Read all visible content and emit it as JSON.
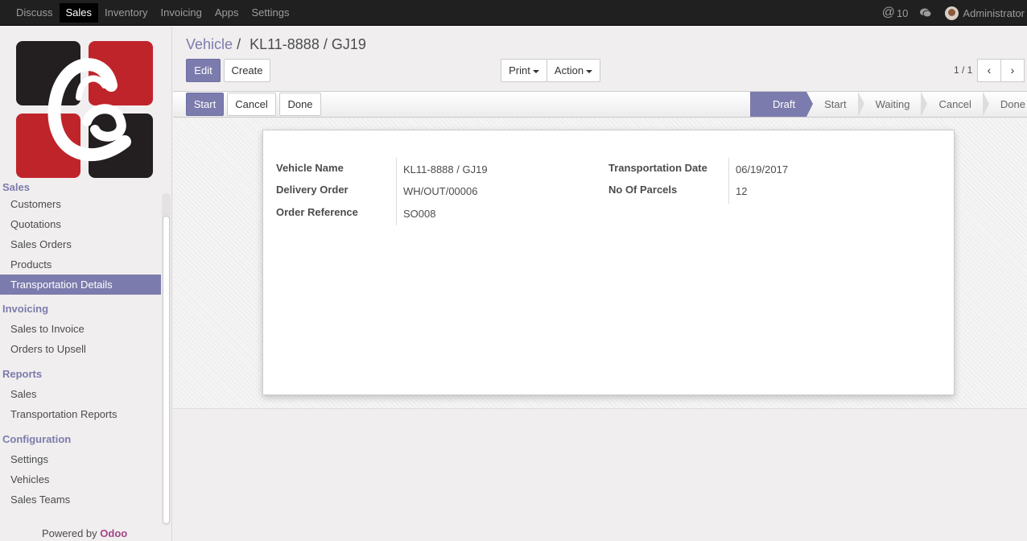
{
  "topbar": {
    "menu": [
      "Discuss",
      "Sales",
      "Inventory",
      "Invoicing",
      "Apps",
      "Settings"
    ],
    "notifications": "10",
    "user": "Administrator"
  },
  "sidebar": {
    "sections": [
      {
        "title": "Sales",
        "items": [
          "Customers",
          "Quotations",
          "Sales Orders",
          "Products",
          "Transportation Details"
        ]
      },
      {
        "title": "Invoicing",
        "items": [
          "Sales to Invoice",
          "Orders to Upsell"
        ]
      },
      {
        "title": "Reports",
        "items": [
          "Sales",
          "Transportation Reports"
        ]
      },
      {
        "title": "Configuration",
        "items": [
          "Settings",
          "Vehicles",
          "Sales Teams"
        ]
      }
    ],
    "active_item": "Transportation Details",
    "powered_by": "Powered by",
    "brand": "Odoo"
  },
  "breadcrumb": {
    "parent": "Vehicle",
    "separator": "/",
    "current": "KL11-8888 / GJ19"
  },
  "buttons": {
    "edit": "Edit",
    "create": "Create",
    "print": "Print",
    "action": "Action"
  },
  "pager": {
    "text": "1 / 1",
    "prev": "‹",
    "next": "›"
  },
  "statusbar": {
    "buttons": {
      "start": "Start",
      "cancel": "Cancel",
      "done": "Done"
    },
    "stages": [
      "Draft",
      "Start",
      "Waiting",
      "Cancel",
      "Done"
    ],
    "active_stage": "Draft"
  },
  "form": {
    "vehicle_name": {
      "label": "Vehicle Name",
      "value": "KL11-8888 / GJ19"
    },
    "delivery_order": {
      "label": "Delivery Order",
      "value": "WH/OUT/00006"
    },
    "order_reference": {
      "label": "Order Reference",
      "value": "SO008"
    },
    "transportation_date": {
      "label": "Transportation Date",
      "value": "06/19/2017"
    },
    "no_of_parcels": {
      "label": "No Of Parcels",
      "value": "12"
    }
  },
  "colors": {
    "brand": "#7c7bad",
    "topbar": "#202020",
    "logo_red": "#c0242b",
    "logo_dark": "#231f20"
  }
}
